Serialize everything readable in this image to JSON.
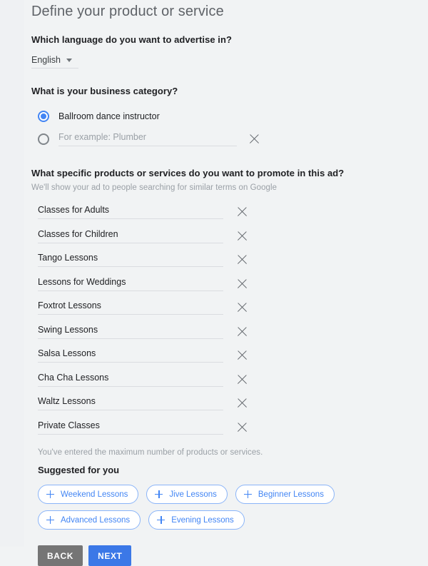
{
  "page": {
    "title": "Define your product or service"
  },
  "language_section": {
    "question": "Which language do you want to advertise in?",
    "selected": "English",
    "caret_icon": "chevron-down-icon"
  },
  "category_section": {
    "question": "What is your business category?",
    "options": [
      {
        "label": "Ballroom dance instructor",
        "selected": true
      },
      {
        "placeholder": "For example: Plumber",
        "value": "",
        "selected": false,
        "clear_icon": "close-icon"
      }
    ]
  },
  "products_section": {
    "question": "What specific products or services do you want to promote in this ad?",
    "subtitle": "We'll show your ad to people searching for similar terms on Google",
    "items": [
      "Classes for Adults",
      "Classes for Children",
      "Tango Lessons",
      "Lessons for Weddings",
      "Foxtrot Lessons",
      "Swing Lessons",
      "Salsa Lessons",
      "Cha Cha Lessons",
      "Waltz Lessons",
      "Private Classes"
    ],
    "clear_icon": "close-icon",
    "max_note": "You've entered the maximum number of products or services."
  },
  "suggestions": {
    "title": "Suggested for you",
    "add_icon": "plus-icon",
    "chips": [
      "Weekend Lessons",
      "Jive Lessons",
      "Beginner Lessons",
      "Advanced Lessons",
      "Evening Lessons"
    ]
  },
  "footer": {
    "back_label": "BACK",
    "next_label": "NEXT"
  },
  "colors": {
    "accent_blue": "#4285f4",
    "next_button": "#3b78e7",
    "back_button": "#757575",
    "chip_border": "#8ab4f8",
    "page_background": "#f1f3f4"
  }
}
